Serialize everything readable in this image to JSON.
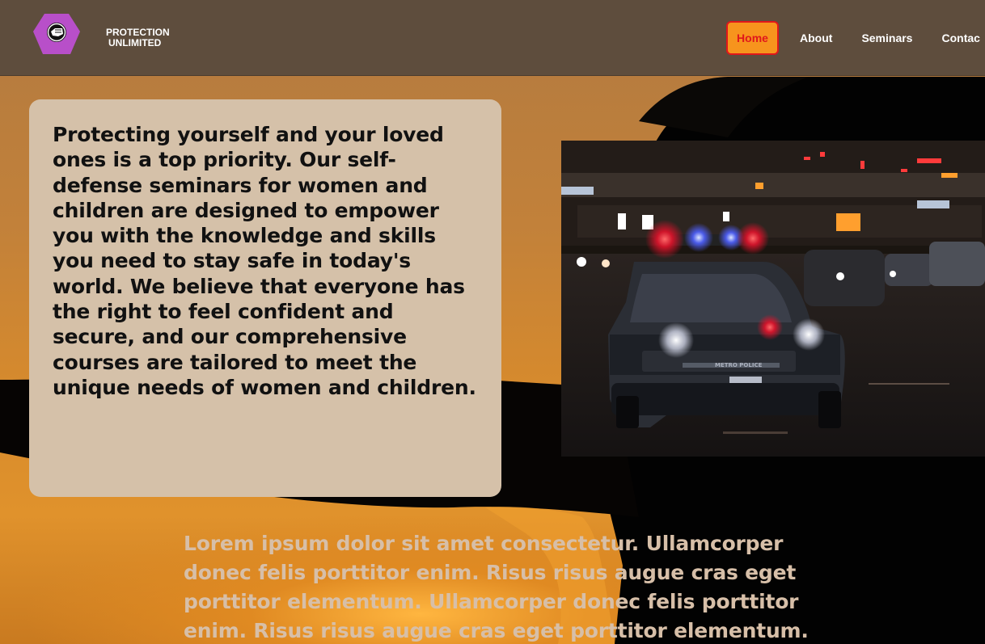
{
  "brand": {
    "line1": "PROTECTION",
    "line2": "UNLIMITED"
  },
  "nav": {
    "items": [
      "Home",
      "About",
      "Seminars",
      "Contac"
    ],
    "active": "Home"
  },
  "intro": {
    "text": "Protecting yourself and your loved ones is a top priority. Our self-defense seminars for women and children are designed to empower you with the knowledge and skills you need to stay safe in today's world. We believe that everyone has the right to feel confident and secure, and our comprehensive courses are tailored to meet the unique needs of women and children."
  },
  "photo": {
    "car_door_text": "METRO POLICE"
  },
  "lorem": {
    "text": "Lorem ipsum dolor sit amet consectetur. Ullamcorper donec felis porttitor enim. Risus risus augue cras eget porttitor elementum. Ullamcorper donec felis porttitor enim. Risus risus augue cras eget porttitor elementum."
  },
  "colors": {
    "header_bg": "#5e4d3d",
    "card_bg": "#d5c1a9",
    "active_nav_bg": "#f7941d",
    "active_nav_text": "#e0171b",
    "logo_purple": "#b84fc9",
    "lorem_text": "#d7bfa8"
  }
}
